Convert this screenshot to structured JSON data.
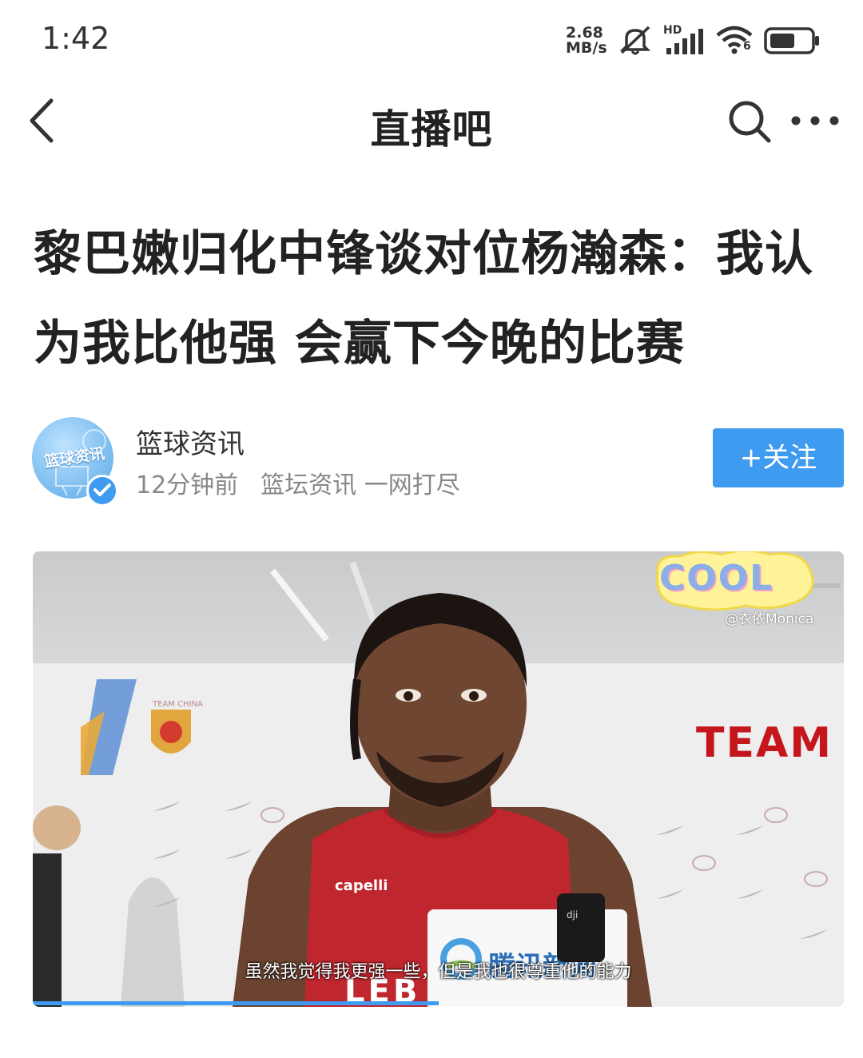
{
  "status_bar": {
    "time": "1:42",
    "network_speed_value": "2.68",
    "network_speed_unit": "MB/s",
    "network_type": "HD",
    "wifi_label": "6"
  },
  "nav": {
    "title": "直播吧"
  },
  "article": {
    "headline": "黎巴嫩归化中锋谈对位杨瀚森：我认为我比他强 会赢下今晚的比赛"
  },
  "author": {
    "avatar_text": "篮球资讯",
    "name": "篮球资讯",
    "time_ago": "12分钟前",
    "description": "篮坛资讯 一网打尽",
    "follow_label": "+关注"
  },
  "video": {
    "backdrop_word": "TEAM",
    "backdrop_logo_text": "TEAM CHINA",
    "sticker_text": "COOL",
    "watermark": "@衣依Monica",
    "mic_label": "腾讯新闻",
    "subtitle": "虽然我觉得我更强一些，但是我也很尊重他的能力",
    "progress_fraction": 0.5,
    "jersey_brand": "capelli",
    "jersey_text": "LEB"
  },
  "colors": {
    "accent": "#3e9bf0",
    "team_red": "#c4161c",
    "jersey_red": "#c0262e"
  }
}
